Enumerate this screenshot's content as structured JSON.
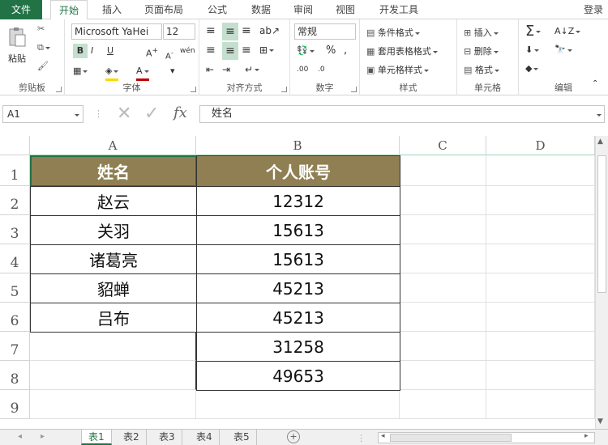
{
  "ribbon_tabs": {
    "file": "文件",
    "items": [
      "开始",
      "插入",
      "页面布局",
      "公式",
      "数据",
      "审阅",
      "视图",
      "开发工具"
    ],
    "login": "登录"
  },
  "ribbon": {
    "clipboard": {
      "name": "剪贴板",
      "paste": "粘贴"
    },
    "font": {
      "name": "字体",
      "family": "Microsoft YaHei",
      "size": "12",
      "bold": "B",
      "italic": "I",
      "underline": "U",
      "wen": "wén"
    },
    "align": {
      "name": "对齐方式"
    },
    "number": {
      "name": "数字",
      "format": "常规",
      "percent": "%",
      "comma": ","
    },
    "styles": {
      "name": "样式",
      "cond": "条件格式",
      "table": "套用表格格式",
      "cell": "单元格样式"
    },
    "cells": {
      "name": "单元格",
      "insert": "插入",
      "delete": "删除",
      "format": "格式"
    },
    "edit": {
      "name": "编辑",
      "sum": "Σ"
    }
  },
  "formula_bar": {
    "namebox": "A1",
    "fx": "fx",
    "content": "姓名"
  },
  "columns": [
    "A",
    "B",
    "C",
    "D"
  ],
  "rows": [
    "1",
    "2",
    "3",
    "4",
    "5",
    "6",
    "7",
    "8",
    "9"
  ],
  "table": {
    "headers": [
      "姓名",
      "个人账号"
    ],
    "names": [
      "赵云",
      "关羽",
      "诸葛亮",
      "貂蝉",
      "吕布",
      "",
      ""
    ],
    "accounts": [
      "12312",
      "15613",
      "15613",
      "45213",
      "45213",
      "31258",
      "49653"
    ]
  },
  "sheets": [
    "表1",
    "表2",
    "表3",
    "表4",
    "表5"
  ],
  "colors": {
    "accent": "#217346",
    "header_fill": "#8f7f52"
  }
}
